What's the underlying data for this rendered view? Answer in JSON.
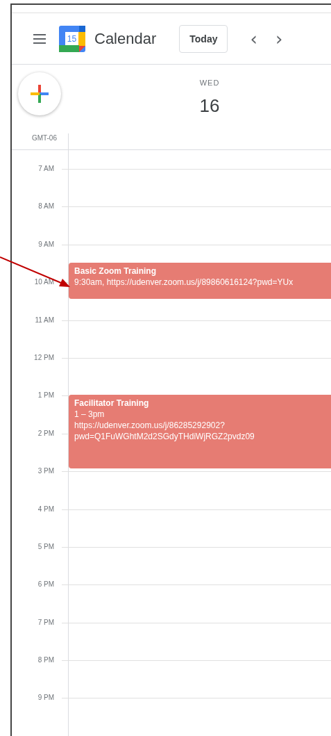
{
  "header": {
    "app_name": "Calendar",
    "logo_number": "15",
    "today_button": "Today",
    "prev": "‹",
    "next": "›"
  },
  "day": {
    "weekday": "WED",
    "date": "16"
  },
  "timezone": "GMT-06",
  "hours": [
    "7 AM",
    "8 AM",
    "9 AM",
    "10 AM",
    "11 AM",
    "12 PM",
    "1 PM",
    "2 PM",
    "3 PM",
    "4 PM",
    "5 PM",
    "6 PM",
    "7 PM",
    "8 PM",
    "9 PM"
  ],
  "events": [
    {
      "title": "Basic Zoom Training",
      "lines": [
        "9:30am, https://udenver.zoom.us/j/89860616124?pwd=YUx"
      ],
      "color": "#e67c73"
    },
    {
      "title": "Facilitator Training",
      "lines": [
        "1 – 3pm",
        "https://udenver.zoom.us/j/86285292902?",
        "pwd=Q1FuWGhtM2d2SGdyTHdiWjRGZ2pvdz09"
      ],
      "color": "#e67c73"
    }
  ]
}
